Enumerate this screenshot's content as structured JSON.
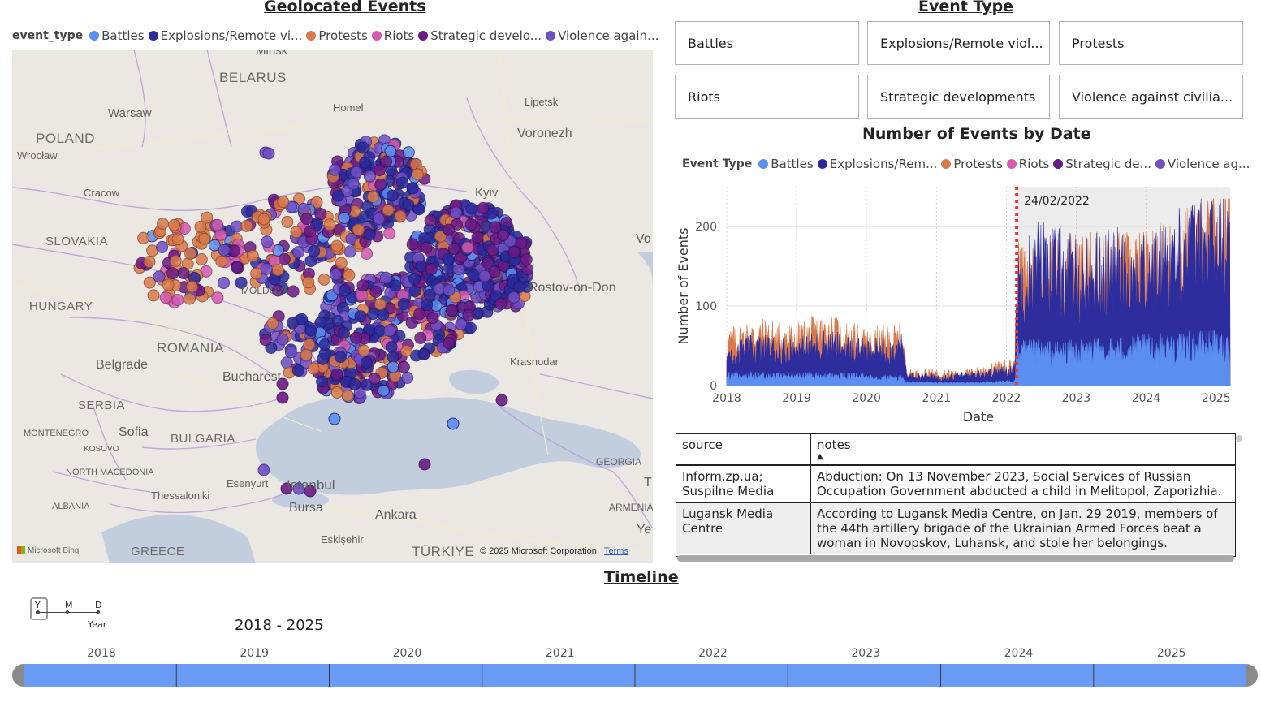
{
  "map": {
    "title": "Geolocated Events",
    "legend_title": "event_type",
    "legend": [
      {
        "label": "Battles",
        "color": "#5a8ef0"
      },
      {
        "label": "Explosions/Remote vi...",
        "color": "#2a2a9c"
      },
      {
        "label": "Protests",
        "color": "#d9794a"
      },
      {
        "label": "Riots",
        "color": "#d35bb0"
      },
      {
        "label": "Strategic develo...",
        "color": "#6b1a86"
      },
      {
        "label": "Violence again...",
        "color": "#6f4fc6"
      }
    ],
    "labels": {
      "minsk": "Minsk",
      "belarus": "BELARUS",
      "warsaw": "Warsaw",
      "poland": "POLAND",
      "homel": "Homel",
      "lipetsk": "Lipetsk",
      "voronezh": "Voronezh",
      "wroclaw": "Wrocław",
      "cracow": "Cracow",
      "kyiv": "Kyiv",
      "slovakia": "SLOVAKIA",
      "vo": "Vo",
      "moldova": "MOLDOVA",
      "rostov": "Rostov-on-Don",
      "hungary": "HUNGARY",
      "romania": "ROMANIA",
      "belgrade": "Belgrade",
      "bucharest": "Bucharest",
      "krasnodar": "Krasnodar",
      "serbia": "SERBIA",
      "montenegro": "MONTENEGRO",
      "sofia": "Sofia",
      "bulgaria": "BULGARIA",
      "kosovo": "KOSOVO",
      "georgia": "GEORGIA",
      "north_macedonia": "NORTH MACEDONIA",
      "esenyurt": "Esenyurt",
      "istanbul": "Istanbul",
      "thessaloniki": "Thessaloniki",
      "bursa": "Bursa",
      "albania": "ALBANIA",
      "ankara": "Ankara",
      "armenia": "ARMENIA",
      "ye": "Ye",
      "eskisehir": "Eskişehir",
      "greece": "GREECE",
      "turkiye": "TÜRKIYE",
      "t": "T"
    },
    "bing": "Microsoft Bing",
    "copyright": "© 2025 Microsoft Corporation",
    "terms": "Terms"
  },
  "slicer": {
    "title": "Event Type",
    "options": [
      "Battles",
      "Explosions/Remote viol...",
      "Protests",
      "Riots",
      "Strategic developments",
      "Violence against civilia..."
    ]
  },
  "chart": {
    "legend_title": "Event Type",
    "legend": [
      "Battles",
      "Explosions/Rem...",
      "Protests",
      "Riots",
      "Strategic de...",
      "Violence ag..."
    ]
  },
  "chart_data": {
    "type": "area",
    "title": "Number of Events by Date",
    "xlabel": "Date",
    "ylabel": "Number of Events",
    "x_ticks": [
      "2018",
      "2019",
      "2020",
      "2021",
      "2022",
      "2023",
      "2024",
      "2025"
    ],
    "y_ticks": [
      0,
      100,
      200
    ],
    "xlim": [
      "2018-01-01",
      "2025-03-15"
    ],
    "ylim": [
      0,
      250
    ],
    "annotation": {
      "date": "2022-02-24",
      "label": "24/02/2022"
    },
    "series": [
      {
        "name": "Battles",
        "color": "#5a8ef0",
        "points": [
          [
            "2018-01-01",
            12
          ],
          [
            "2019-01-01",
            12
          ],
          [
            "2020-01-01",
            11
          ],
          [
            "2020-07-01",
            9
          ],
          [
            "2020-08-01",
            4
          ],
          [
            "2021-06-01",
            3
          ],
          [
            "2022-02-15",
            5
          ],
          [
            "2022-02-24",
            40
          ],
          [
            "2023-01-01",
            40
          ],
          [
            "2024-01-01",
            45
          ],
          [
            "2025-03-15",
            50
          ]
        ]
      },
      {
        "name": "Explosions/Remote violence",
        "color": "#2d2d9e",
        "points": [
          [
            "2018-01-01",
            38
          ],
          [
            "2018-06-01",
            45
          ],
          [
            "2019-01-01",
            42
          ],
          [
            "2019-06-01",
            50
          ],
          [
            "2020-01-01",
            40
          ],
          [
            "2020-07-01",
            45
          ],
          [
            "2020-08-01",
            12
          ],
          [
            "2021-01-01",
            10
          ],
          [
            "2021-06-01",
            12
          ],
          [
            "2022-01-01",
            18
          ],
          [
            "2022-02-15",
            20
          ],
          [
            "2022-02-24",
            120
          ],
          [
            "2022-07-01",
            150
          ],
          [
            "2023-01-01",
            130
          ],
          [
            "2023-07-01",
            140
          ],
          [
            "2024-01-01",
            130
          ],
          [
            "2024-07-01",
            160
          ],
          [
            "2025-03-15",
            170
          ]
        ]
      },
      {
        "name": "Protests",
        "color": "#d9794a",
        "points": [
          [
            "2018-01-01",
            50
          ],
          [
            "2018-06-01",
            60
          ],
          [
            "2019-01-01",
            55
          ],
          [
            "2019-06-01",
            65
          ],
          [
            "2020-01-01",
            50
          ],
          [
            "2020-07-01",
            55
          ],
          [
            "2020-08-01",
            15
          ],
          [
            "2021-06-01",
            14
          ],
          [
            "2022-02-15",
            25
          ],
          [
            "2022-02-24",
            125
          ],
          [
            "2023-01-01",
            135
          ],
          [
            "2024-01-01",
            135
          ],
          [
            "2025-03-15",
            180
          ]
        ]
      }
    ]
  },
  "table": {
    "headers": [
      "source",
      "notes"
    ],
    "rows": [
      [
        "Inform.zp.ua; Suspilne Media",
        "Abduction: On 13 November 2023, Social Services of Russian Occupation Government abducted a child in Melitopol, Zaporizhia."
      ],
      [
        "Lugansk Media Centre",
        "According to Lugansk Media Centre, on Jan. 29 2019, members of the 44th artillery brigade of the Ukrainian Armed Forces beat a woman in Novopskov, Luhansk, and stole her belongings."
      ]
    ]
  },
  "timeline": {
    "title": "Timeline",
    "granularity": [
      "Y",
      "M",
      "D"
    ],
    "selected_granularity": "Y",
    "granularity_label": "Year",
    "range": "2018 - 2025",
    "years": [
      "2018",
      "2019",
      "2020",
      "2021",
      "2022",
      "2023",
      "2024",
      "2025"
    ],
    "bar_color": "#6b9cf5"
  }
}
